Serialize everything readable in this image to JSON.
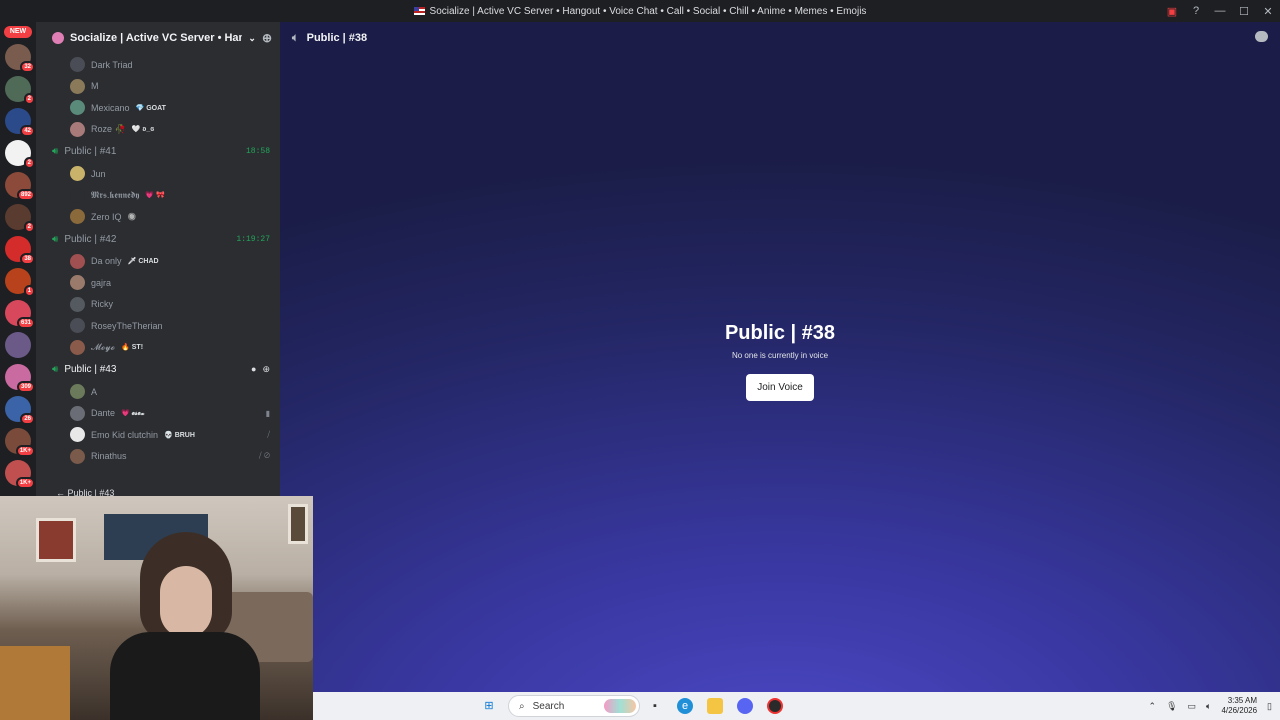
{
  "window": {
    "title": "Socialize | Active VC Server • Hangout • Voice Chat • Call • Social • Chill • Anime • Memes • Emojis"
  },
  "servers": {
    "new_label": "NEW",
    "items": [
      {
        "badge": "32",
        "color": "#7a5c4f"
      },
      {
        "badge": "2",
        "color": "#4f6b58"
      },
      {
        "badge": "42",
        "color": "#2b4a8a"
      },
      {
        "badge": "2",
        "color": "#f2f2f2"
      },
      {
        "badge": "892",
        "color": "#8b4a3a"
      },
      {
        "badge": "2",
        "color": "#5a3b30"
      },
      {
        "badge": "38",
        "color": "#d42b2b"
      },
      {
        "badge": "1",
        "color": "#b8421c"
      },
      {
        "badge": "631",
        "color": "#d8485c"
      },
      {
        "badge": "",
        "color": "#6b5a88"
      },
      {
        "badge": "309",
        "color": "#c96aa0"
      },
      {
        "badge": "26",
        "color": "#3a63a8"
      },
      {
        "badge": "1K+",
        "color": "#7a4a3a"
      },
      {
        "badge": "1K+",
        "color": "#c05050"
      }
    ]
  },
  "sidebar": {
    "server_name": "Socialize | Active VC Server • Han...",
    "top_users": [
      {
        "name": "Dark Triad",
        "tag": "",
        "color": "#4a4d55"
      },
      {
        "name": "M",
        "tag": "",
        "color": "#8a7a5a"
      },
      {
        "name": "Mexicano",
        "tag": "💎 GOAT",
        "color": "#5a8a7a"
      },
      {
        "name": "Roze 🥀",
        "tag": "🤍 ʚ_ɞ",
        "color": "#a87a7a"
      }
    ],
    "vc41": {
      "name": "Public | #41",
      "time": "18:58"
    },
    "vc41_users": [
      {
        "name": "Jun",
        "tag": "",
        "color": "#c9b36a"
      },
      {
        "name": "𝕸𝖗𝖘.𝖐𝖊𝖓𝖓𝖊𝖉𝖞",
        "tag": "💗 🎀",
        "color": "#2b2d31"
      },
      {
        "name": "Zero IQ",
        "tag": "🔘",
        "color": "#8a6a3a"
      }
    ],
    "vc42": {
      "name": "Public | #42",
      "time": "1:19:27"
    },
    "vc42_users": [
      {
        "name": "Da only",
        "tag": "🗡 CHAD",
        "color": "#a05050"
      },
      {
        "name": "gajra",
        "tag": "",
        "color": "#9a7a6a"
      },
      {
        "name": "Ricky",
        "tag": "",
        "color": "#555a60"
      },
      {
        "name": "RoseyTheTherian",
        "tag": "",
        "color": "#4a4d55"
      },
      {
        "name": "𝓜𝓸𝔂𝓸",
        "tag": "🔥 ST!",
        "color": "#8a5a4a"
      }
    ],
    "vc43": {
      "name": "Public | #43"
    },
    "vc43_users": [
      {
        "name": "A",
        "tag": "",
        "color": "#6a7a5a",
        "right": ""
      },
      {
        "name": "Dante",
        "tag": "💗 𝓮𝓼𝓮𝔁",
        "color": "#6a6d75",
        "right": "▮"
      },
      {
        "name": "Emo Kid clutchin",
        "tag": "💀 BRUH",
        "color": "#e8e8e8",
        "right": "⧸"
      },
      {
        "name": "Rinathus",
        "tag": "",
        "color": "#7a5a4a",
        "right": "⧸ ⊘"
      }
    ],
    "connected_bar": "Public | #43"
  },
  "main": {
    "channel_name": "Public | #38",
    "heading": "Public | #38",
    "subtext": "No one is currently in voice",
    "join_label": "Join Voice"
  },
  "taskbar": {
    "search_label": "Search",
    "time": "3:35 AM",
    "date": "4/26/2026"
  }
}
